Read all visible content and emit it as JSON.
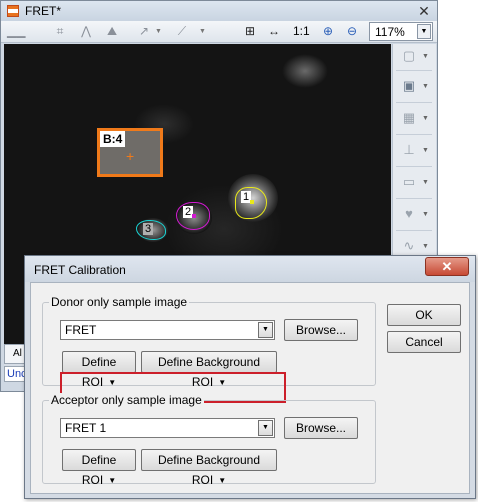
{
  "fret_window": {
    "title": "FRET*",
    "close_icon": "close-icon",
    "toolbar": {
      "ratio_label": "1:1",
      "zoom_value": "117%"
    },
    "image": {
      "rois": [
        {
          "label": "B:4",
          "color": "#f07a1a"
        },
        {
          "label": "1",
          "color": "#e8e81a"
        },
        {
          "label": "2",
          "color": "#d21ad2"
        },
        {
          "label": "3",
          "color": "#1ad2d2"
        }
      ]
    },
    "tab_label": "Al",
    "status_text": "Unc"
  },
  "dialog": {
    "title": "FRET Calibration",
    "close_label": "✕",
    "donor": {
      "group_label": "Donor only sample image",
      "image_value": "FRET",
      "browse_label": "Browse...",
      "define_roi_label": "Define ROI",
      "define_bg_roi_label": "Define Background ROI"
    },
    "acceptor": {
      "group_label": "Acceptor only sample image",
      "image_value": "FRET 1",
      "browse_label": "Browse...",
      "define_roi_label": "Define ROI",
      "define_bg_roi_label": "Define Background ROI"
    },
    "ok_label": "OK",
    "cancel_label": "Cancel",
    "highlight_color": "#cc1f2a"
  }
}
